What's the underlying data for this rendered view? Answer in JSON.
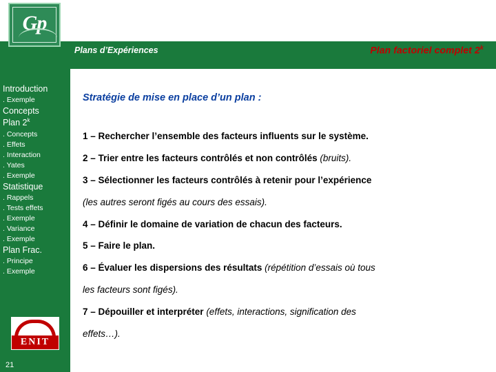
{
  "header": {
    "logo_text": "Gp",
    "left_title": "Plans d’Expériences",
    "right_title_main": "Plan factoriel complet 2",
    "right_title_sup": "k"
  },
  "sidebar": {
    "items": [
      {
        "label": "Introduction",
        "type": "heading"
      },
      {
        "label": ". Exemple",
        "type": "sub"
      },
      {
        "label": "Concepts",
        "type": "heading"
      },
      {
        "label": "Plan 2",
        "sup": "k",
        "type": "heading"
      },
      {
        "label": ". Concepts",
        "type": "sub"
      },
      {
        "label": ". Effets",
        "type": "sub"
      },
      {
        "label": ". Interaction",
        "type": "sub"
      },
      {
        "label": ". Yates",
        "type": "sub"
      },
      {
        "label": ". Exemple",
        "type": "sub"
      },
      {
        "label": "Statistique",
        "type": "heading"
      },
      {
        "label": ". Rappels",
        "type": "sub"
      },
      {
        "label": ". Tests effets",
        "type": "sub"
      },
      {
        "label": ". Exemple",
        "type": "sub"
      },
      {
        "label": ". Variance",
        "type": "sub"
      },
      {
        "label": ". Exemple",
        "type": "sub"
      },
      {
        "label": "Plan Frac.",
        "type": "heading"
      },
      {
        "label": ". Principe",
        "type": "sub"
      },
      {
        "label": ". Exemple",
        "type": "sub"
      }
    ],
    "enit_logo_text": "ENIT",
    "page_number": "21"
  },
  "main": {
    "section_title": "Stratégie de mise en place d’un plan :",
    "steps": [
      {
        "id": "step-1",
        "bold": "1 – Rechercher l’ensemble des facteurs influents sur le système.",
        "italic": ""
      },
      {
        "id": "step-2",
        "bold": "2 – Trier entre les facteurs contrôlés et non contrôlés ",
        "italic": "(bruits)."
      },
      {
        "id": "step-3",
        "bold": "3 – Sélectionner les facteurs contrôlés à retenir pour l’expérience",
        "italic": ""
      },
      {
        "id": "step-3-note",
        "bold": "",
        "italic": "(les autres seront figés au cours des essais)."
      },
      {
        "id": "step-4",
        "bold": "4 – Définir le domaine de variation de chacun des facteurs.",
        "italic": ""
      },
      {
        "id": "step-5",
        "bold": "5 – Faire le plan.",
        "italic": ""
      },
      {
        "id": "step-6",
        "bold": "6 – Évaluer les dispersions des résultats ",
        "italic": "(répétition d’essais où tous"
      },
      {
        "id": "step-6-cont",
        "bold": "",
        "italic": "les facteurs sont figés)."
      },
      {
        "id": "step-7",
        "bold": "7 – Dépouiller et interpréter ",
        "italic": "(effets, interactions, signification des"
      },
      {
        "id": "step-7-cont",
        "bold": "",
        "italic": "effets…)."
      }
    ]
  },
  "colors": {
    "green": "#1a7a3c",
    "blue": "#0b3fa0",
    "red": "#c00000"
  }
}
